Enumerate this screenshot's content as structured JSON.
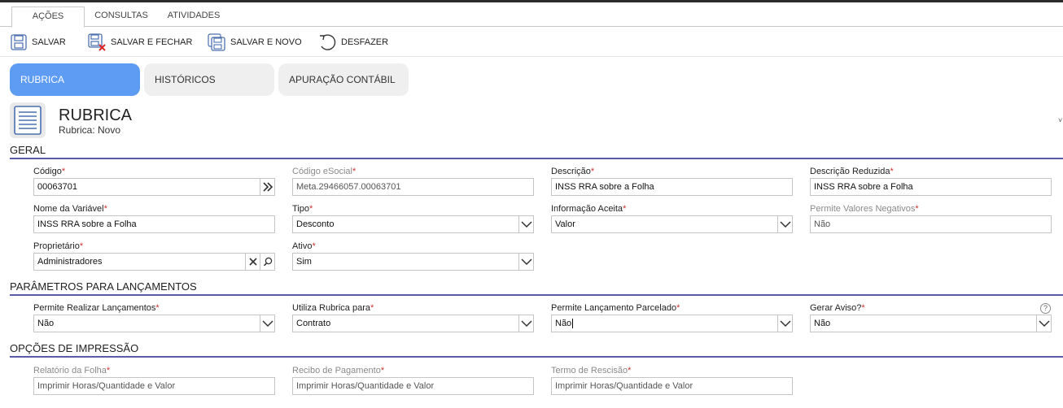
{
  "main_tabs": [
    "AÇÕES",
    "CONSULTAS",
    "ATIVIDADES"
  ],
  "toolbar": {
    "save": "SALVAR",
    "save_close": "SALVAR E FECHAR",
    "save_new": "SALVAR E NOVO",
    "undo": "DESFAZER"
  },
  "sub_tabs": [
    "RUBRICA",
    "HISTÓRICOS",
    "APURAÇÃO CONTÁBIL"
  ],
  "record": {
    "title": "RUBRICA",
    "subtitle": "Rubrica: Novo"
  },
  "required_mark": "*",
  "sections": {
    "geral": "GERAL",
    "parametros": "PARÂMETROS PARA LANÇAMENTOS",
    "impressao": "OPÇÕES DE IMPRESSÃO"
  },
  "fields": {
    "codigo": {
      "label": "Código",
      "value": "00063701"
    },
    "codigo_esocial": {
      "label": "Código eSocial",
      "value": "Meta.29466057.00063701"
    },
    "descricao": {
      "label": "Descrição",
      "value": "INSS RRA sobre a Folha"
    },
    "descricao_reduzida": {
      "label": "Descrição Reduzida",
      "value": "INSS RRA sobre a Folha"
    },
    "nome_variavel": {
      "label": "Nome da Variável",
      "value": "INSS RRA sobre a Folha"
    },
    "tipo": {
      "label": "Tipo",
      "value": "Desconto"
    },
    "informacao_aceita": {
      "label": "Informação Aceita",
      "value": "Valor"
    },
    "permite_negativos": {
      "label": "Permite Valores Negativos",
      "value": "Não"
    },
    "proprietario": {
      "label": "Proprietário",
      "value": "Administradores"
    },
    "ativo": {
      "label": "Ativo",
      "value": "Sim"
    },
    "permite_lancamentos": {
      "label": "Permite Realizar Lançamentos",
      "value": "Não"
    },
    "utiliza_rubrica": {
      "label": "Utiliza Rubrica para",
      "value": "Contrato"
    },
    "lancamento_parcelado": {
      "label": "Permite Lançamento Parcelado",
      "value": "Não"
    },
    "gerar_aviso": {
      "label": "Gerar Aviso?",
      "value": "Não"
    },
    "relatorio_folha": {
      "label": "Relatório da Folha",
      "value": "Imprimir Horas/Quantidade e Valor"
    },
    "recibo_pagamento": {
      "label": "Recibo de Pagamento",
      "value": "Imprimir Horas/Quantidade e Valor"
    },
    "termo_rescisao": {
      "label": "Termo de Rescisão",
      "value": "Imprimir Horas/Quantidade e Valor"
    }
  },
  "help_glyph": "?",
  "chevron_glyph": "˅",
  "colors": {
    "active_tab": "#5e9cf4",
    "section_rule": "#5a5aa8",
    "required": "#cc3333"
  }
}
